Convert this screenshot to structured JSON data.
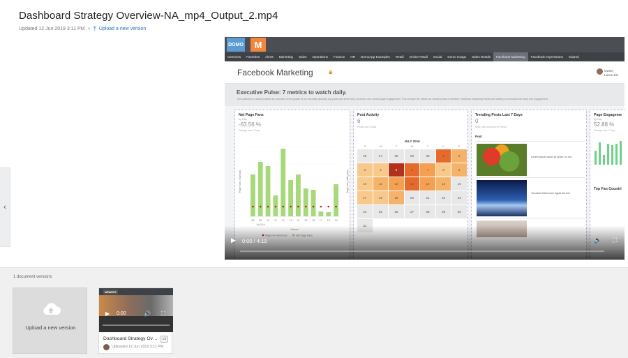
{
  "header": {
    "title": "Dashboard Strategy Overview-NA_mp4_Output_2.mp4",
    "updated": "Updated 12 Jun 2019 3:11 PM",
    "separator": "•",
    "upload_link": "Upload a new version",
    "upload_icon": "upload-icon"
  },
  "nav": {
    "prev_icon": "chevron-left-icon",
    "prev_glyph": "‹"
  },
  "video": {
    "logo_text": "DOMO",
    "logo2_text": "M",
    "tabs": [
      "Overview",
      "Favorites",
      "Alerts",
      "Marketing",
      "Sales",
      "Operations",
      "Finance",
      "HR",
      "DomoApp Examples",
      "Retail",
      "Online Retail",
      "Social",
      "Domo Usage",
      "Sales Details",
      "Facebook Marketing",
      "Facebook Impressions",
      "Shared"
    ],
    "active_tab": "Facebook Marketing",
    "page_title": "Facebook Marketing",
    "owner_label": "Owner",
    "owner_name": "Lance Riv",
    "exec_title": "Executive Pulse: 7 metrics to watch daily.",
    "exec_desc": "This collection of cards provide an overview of the growth of our fan base globally, top posts and when they occurred, and overall page engagement. This will give the viewer an overall sense of whether Facebook marketing efforts are leading to increased fan base and engagement.",
    "cards": {
      "fans": {
        "title": "Net Page Fans",
        "sub": "by Day",
        "value": "-63.56 %",
        "sub2": "Change over 7 Days",
        "xlabel": "Period",
        "ylabel": "Page Fans (Symbol)",
        "y2label": "Net Page Fans (Bar)",
        "legend1": "Page Fan Removes",
        "legend2": "Net Page Fans",
        "xsub": "Jul 2016"
      },
      "posts": {
        "title": "Post Activity",
        "value": "6",
        "sub": "Posts Last 7 Days",
        "cal_title": "JULY 2016"
      },
      "trending": {
        "title": "Trending Posts Last 7 Days",
        "value": "0",
        "sub": "Most Likes Acquired in Period",
        "col": "Post",
        "post1": "Lorem ipsum dolor sit amet, eu me",
        "post2": "Tincidunt bibendum ligula dis orci"
      },
      "engage": {
        "title": "Page Engageme",
        "sub": "by Day",
        "value": "52.88 %",
        "sub2": "Change over 7 Days",
        "sub3": "Top Fan Countri"
      }
    },
    "calendar_dow": [
      "S",
      "M",
      "T",
      "W",
      "T",
      "F",
      "S"
    ],
    "calendar": [
      {
        "d": "26",
        "c": "#e8e8e8"
      },
      {
        "d": "27",
        "c": "#e8e8e8"
      },
      {
        "d": "28",
        "c": "#e8e8e8"
      },
      {
        "d": "29",
        "c": "#e8e8e8"
      },
      {
        "d": "30",
        "c": "#e8e8e8"
      },
      {
        "d": "1",
        "c": "#e86a2a"
      },
      {
        "d": "2",
        "c": "#f5b36a"
      },
      {
        "d": "3",
        "c": "#f8c98a"
      },
      {
        "d": "4",
        "c": "#f8c98a"
      },
      {
        "d": "5",
        "c": "#b3311a"
      },
      {
        "d": "6",
        "c": "#e86a2a"
      },
      {
        "d": "7",
        "c": "#f5a050"
      },
      {
        "d": "8",
        "c": "#f8c98a"
      },
      {
        "d": "9",
        "c": "#f5b36a"
      },
      {
        "d": "10",
        "c": "#f8c98a"
      },
      {
        "d": "11",
        "c": "#f5b36a"
      },
      {
        "d": "12",
        "c": "#f5a050"
      },
      {
        "d": "13",
        "c": "#e86a2a"
      },
      {
        "d": "14",
        "c": "#f5a050"
      },
      {
        "d": "15",
        "c": "#f5b36a"
      },
      {
        "d": "16",
        "c": "#e8e8e8"
      },
      {
        "d": "17",
        "c": "#f8c98a"
      },
      {
        "d": "18",
        "c": "#f8c98a"
      },
      {
        "d": "19",
        "c": "#f5b36a"
      },
      {
        "d": "20",
        "c": "#e8e8e8"
      },
      {
        "d": "21",
        "c": "#e8e8e8"
      },
      {
        "d": "22",
        "c": "#e8e8e8"
      },
      {
        "d": "23",
        "c": "#e8e8e8"
      },
      {
        "d": "24",
        "c": "#e8e8e8"
      },
      {
        "d": "25",
        "c": "#e8e8e8"
      },
      {
        "d": "26",
        "c": "#e8e8e8"
      },
      {
        "d": "27",
        "c": "#e8e8e8"
      },
      {
        "d": "28",
        "c": "#e8e8e8"
      },
      {
        "d": "29",
        "c": "#e8e8e8"
      },
      {
        "d": "30",
        "c": "#e8e8e8"
      },
      {
        "d": "31",
        "c": "#e8e8e8"
      }
    ],
    "fan_bars": [
      {
        "x": "08",
        "v": 60
      },
      {
        "x": "09",
        "v": 78
      },
      {
        "x": "10",
        "v": 72
      },
      {
        "x": "11",
        "v": 30
      },
      {
        "x": "12",
        "v": 97
      },
      {
        "x": "13",
        "v": 52
      },
      {
        "x": "14",
        "v": 60
      },
      {
        "x": "15",
        "v": 40
      },
      {
        "x": "16",
        "v": 38
      },
      {
        "x": "17",
        "v": 7
      },
      {
        "x": "18",
        "v": 6
      },
      {
        "x": "19",
        "v": 46
      }
    ],
    "time": "0:00 / 4:19",
    "progress": 0,
    "play_icon": "play-icon",
    "volume_icon": "volume-icon",
    "fullscreen_icon": "fullscreen-icon",
    "accent": "#a7d97a"
  },
  "versions": {
    "count_label": "1 document versions",
    "upload_label": "Upload a new version",
    "upload_icon": "cloud-upload-icon",
    "card": {
      "badge_newest": "NEWEST",
      "time": "0:00",
      "name": "Dashboard Strategy Over...",
      "version": "v1",
      "uploaded": "Uploaded 12 Jun 2019 3:11 PM"
    }
  }
}
